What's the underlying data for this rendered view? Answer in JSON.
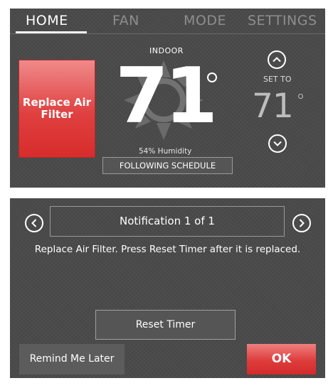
{
  "home": {
    "tabs": [
      {
        "label": "HOME",
        "active": true
      },
      {
        "label": "FAN",
        "active": false
      },
      {
        "label": "MODE",
        "active": false
      },
      {
        "label": "SETTINGS",
        "active": false
      }
    ],
    "alert_tile": {
      "label": "Replace Air Filter",
      "color": "#e04040"
    },
    "indoor": {
      "label": "INDOOR",
      "temperature": "71",
      "humidity": "54% Humidity",
      "mode_icon": "heat-sun-icon"
    },
    "schedule_button": "FOLLOWING SCHEDULE",
    "set_to": {
      "label": "SET TO",
      "temperature": "71",
      "up_icon": "chevron-up-icon",
      "down_icon": "chevron-down-icon"
    }
  },
  "notification": {
    "header": "Notification 1 of 1",
    "prev_icon": "chevron-left-icon",
    "next_icon": "chevron-right-icon",
    "message": "Replace Air Filter. Press Reset Timer after it is replaced.",
    "reset_button": "Reset Timer",
    "remind_button": "Remind Me Later",
    "ok_button": "OK",
    "ok_color": "#de3c3c"
  }
}
